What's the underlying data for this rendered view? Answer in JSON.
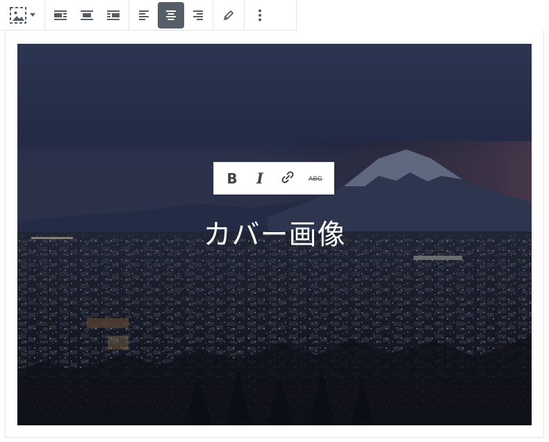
{
  "toolbar": {
    "block_switcher": {
      "icon": "cover-image-icon"
    },
    "alignment_group": [
      {
        "icon": "align-left-wrap-icon"
      },
      {
        "icon": "align-center-wrap-icon"
      },
      {
        "icon": "align-right-wrap-icon"
      }
    ],
    "text_align_group": [
      {
        "icon": "text-align-left-icon",
        "active": false
      },
      {
        "icon": "text-align-center-icon",
        "active": true
      },
      {
        "icon": "text-align-right-icon",
        "active": false
      }
    ],
    "edit": {
      "icon": "pencil-icon"
    },
    "more": {
      "icon": "more-vertical-icon"
    },
    "active_color": "#555d66"
  },
  "format_toolbar": {
    "bold_label": "B",
    "italic_label": "I",
    "link_icon": "link-icon",
    "strike_label": "ABC"
  },
  "cover": {
    "title": "カバー画像",
    "image": "night-city-with-mountain"
  }
}
